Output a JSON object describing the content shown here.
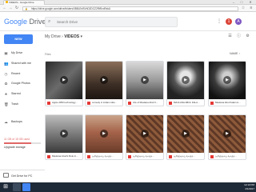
{
  "browser": {
    "tab_title": "VIDEOS - Google Drive",
    "url": "https://drive.google.com/drive/folders/0B8LEnBVhD2DCZ2RtRzdFakU",
    "min": "–",
    "max": "□",
    "close": "✕"
  },
  "header": {
    "logo_google": "Google",
    "logo_drive": "Drive",
    "search_placeholder": "Search Drive"
  },
  "sidebar": {
    "new_label": "NEW",
    "items": [
      {
        "label": "My Drive",
        "icon": "drive-icon"
      },
      {
        "label": "Shared with me",
        "icon": "people-icon"
      },
      {
        "label": "Recent",
        "icon": "clock-icon"
      },
      {
        "label": "Google Photos",
        "icon": "photos-icon"
      },
      {
        "label": "Starred",
        "icon": "star-icon"
      },
      {
        "label": "Trash",
        "icon": "trash-icon"
      },
      {
        "label": "Backups",
        "icon": "backup-icon"
      }
    ],
    "storage_text": "11 GB of 15 GB used",
    "storage_fraction": 0.73,
    "upgrade": "Upgrade storage",
    "get_drive_pc": "Get Drive for PC"
  },
  "main": {
    "breadcrumb_root": "My Drive",
    "breadcrumb_sep": "›",
    "breadcrumb_current": "VIDEOS",
    "files_label": "Files",
    "sort_label": "NAME",
    "files": [
      {
        "name": "Apple 2050 technology...",
        "style": "dark"
      },
      {
        "name": "comedy in indian colle...",
        "style": "crowd"
      },
      {
        "name": "Life of Maulana Abul K...",
        "style": "bw-text"
      },
      {
        "name": "MAULANA ABUL KALA...",
        "style": "bw-portrait"
      },
      {
        "name": "Maulana Abul Kalam A...",
        "style": "bw-portrait2"
      },
      {
        "name": "Maulana Azad's Role in...",
        "style": "bw-people"
      },
      {
        "name": "தமிழ்த்தாய் வாழ்த்...",
        "style": "temple"
      },
      {
        "name": "தமிழ்த்தாய் வாழ்த்...",
        "style": "carving"
      },
      {
        "name": "தமிழ்த்தாய் வாழ்த்...",
        "style": "carving"
      },
      {
        "name": "தமிழ்த்தாய் வாழ்த்...",
        "style": "carving"
      }
    ]
  },
  "taskbar": {
    "start_icon": "windows-icon",
    "time": "12:10 PM",
    "date": "2/1/2017"
  },
  "colors": {
    "accent": "#4285f4",
    "storage": "#e06666"
  }
}
